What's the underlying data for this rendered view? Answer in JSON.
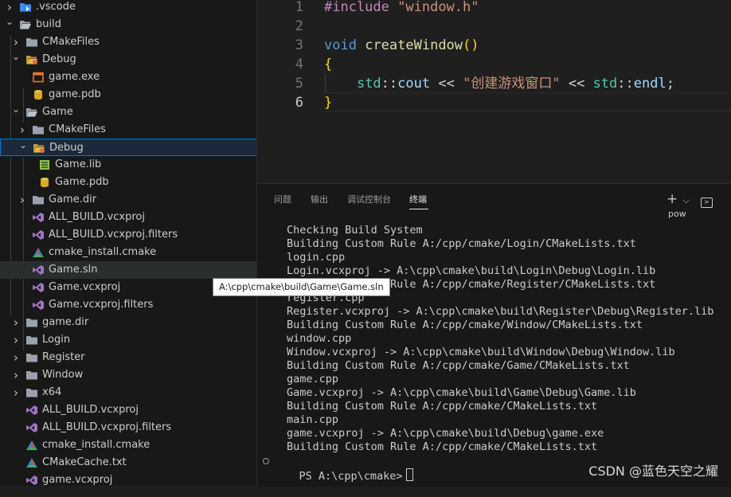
{
  "explorer": {
    "items": [
      {
        "label": ".vscode",
        "icon": "vscode-folder-icon",
        "chevron": "right",
        "depth": 0
      },
      {
        "label": "build",
        "icon": "folder-open-icon",
        "chevron": "down",
        "depth": 0
      },
      {
        "label": "CMakeFiles",
        "icon": "folder-icon",
        "chevron": "right",
        "depth": 1
      },
      {
        "label": "Debug",
        "icon": "debug-folder-open-icon",
        "chevron": "down",
        "depth": 1
      },
      {
        "label": "game.exe",
        "icon": "exe-icon",
        "chevron": "",
        "depth": 2
      },
      {
        "label": "game.pdb",
        "icon": "database-icon",
        "chevron": "",
        "depth": 2
      },
      {
        "label": "Game",
        "icon": "folder-open-icon",
        "chevron": "down",
        "depth": 1
      },
      {
        "label": "CMakeFiles",
        "icon": "folder-icon",
        "chevron": "right",
        "depth": 2
      },
      {
        "label": "Debug",
        "icon": "debug-folder-open-icon",
        "chevron": "down",
        "depth": 2
      },
      {
        "label": "Game.lib",
        "icon": "lib-icon",
        "chevron": "",
        "depth": 3
      },
      {
        "label": "Game.pdb",
        "icon": "database-icon",
        "chevron": "",
        "depth": 3
      },
      {
        "label": "Game.dir",
        "icon": "folder-icon",
        "chevron": "right",
        "depth": 2
      },
      {
        "label": "ALL_BUILD.vcxproj",
        "icon": "visual-studio-icon",
        "chevron": "",
        "depth": 2
      },
      {
        "label": "ALL_BUILD.vcxproj.filters",
        "icon": "visual-studio-icon",
        "chevron": "",
        "depth": 2
      },
      {
        "label": "cmake_install.cmake",
        "icon": "cmake-icon",
        "chevron": "",
        "depth": 2
      },
      {
        "label": "Game.sln",
        "icon": "visual-studio-icon",
        "chevron": "",
        "depth": 2
      },
      {
        "label": "Game.vcxproj",
        "icon": "visual-studio-icon",
        "chevron": "",
        "depth": 2
      },
      {
        "label": "Game.vcxproj.filters",
        "icon": "visual-studio-icon",
        "chevron": "",
        "depth": 2
      },
      {
        "label": "game.dir",
        "icon": "folder-icon",
        "chevron": "right",
        "depth": 1
      },
      {
        "label": "Login",
        "icon": "folder-icon",
        "chevron": "right",
        "depth": 1
      },
      {
        "label": "Register",
        "icon": "folder-icon",
        "chevron": "right",
        "depth": 1
      },
      {
        "label": "Window",
        "icon": "folder-icon",
        "chevron": "right",
        "depth": 1
      },
      {
        "label": "x64",
        "icon": "folder-icon",
        "chevron": "right",
        "depth": 1
      },
      {
        "label": "ALL_BUILD.vcxproj",
        "icon": "visual-studio-icon",
        "chevron": "",
        "depth": 1
      },
      {
        "label": "ALL_BUILD.vcxproj.filters",
        "icon": "visual-studio-icon",
        "chevron": "",
        "depth": 1
      },
      {
        "label": "cmake_install.cmake",
        "icon": "cmake-icon",
        "chevron": "",
        "depth": 1
      },
      {
        "label": "CMakeCache.txt",
        "icon": "cmake-icon",
        "chevron": "",
        "depth": 1
      },
      {
        "label": "game.vcxproj",
        "icon": "visual-studio-icon",
        "chevron": "",
        "depth": 1
      }
    ],
    "selected_label": "Debug",
    "tooltip": "A:\\cpp\\cmake\\build\\Game\\Game.sln"
  },
  "editor": {
    "line_numbers": [
      "1",
      "2",
      "3",
      "4",
      "5",
      "6"
    ],
    "active_line": "6",
    "code": {
      "line1_directive": "#include",
      "line1_header": "\"window.h\"",
      "line3_type": "void",
      "line3_name": "createWindow",
      "line3_parens": "()",
      "line4_open": "{",
      "line5_ns1": "std",
      "line5_sep1": "::",
      "line5_cout": "cout",
      "line5_op1": "<<",
      "line5_str": "\"创建游戏窗口\"",
      "line5_op2": "<<",
      "line5_ns2": "std",
      "line5_sep2": "::",
      "line5_endl": "endl",
      "line5_semi": ";",
      "line6_close": "}"
    }
  },
  "panel": {
    "tabs": [
      "问题",
      "输出",
      "调试控制台",
      "终端"
    ],
    "active_tab": "终端",
    "new_terminal_label": "+",
    "dropdown_label": "⌵",
    "shell_label": "pow",
    "terminal_lines": [
      "Checking Build System",
      "Building Custom Rule A:/cpp/cmake/Login/CMakeLists.txt",
      "login.cpp",
      "Login.vcxproj -> A:\\cpp\\cmake\\build\\Login\\Debug\\Login.lib",
      "Building Custom Rule A:/cpp/cmake/Register/CMakeLists.txt",
      "register.cpp",
      "Register.vcxproj -> A:\\cpp\\cmake\\build\\Register\\Debug\\Register.lib",
      "Building Custom Rule A:/cpp/cmake/Window/CMakeLists.txt",
      "window.cpp",
      "Window.vcxproj -> A:\\cpp\\cmake\\build\\Window\\Debug\\Window.lib",
      "Building Custom Rule A:/cpp/cmake/Game/CMakeLists.txt",
      "game.cpp",
      "Game.vcxproj -> A:\\cpp\\cmake\\build\\Game\\Debug\\Game.lib",
      "Building Custom Rule A:/cpp/cmake/CMakeLists.txt",
      "main.cpp",
      "game.vcxproj -> A:\\cpp\\cmake\\build\\Debug\\game.exe",
      "Building Custom Rule A:/cpp/cmake/CMakeLists.txt"
    ],
    "prompt": "PS A:\\cpp\\cmake>"
  },
  "watermark": "CSDN @蓝色天空之耀"
}
